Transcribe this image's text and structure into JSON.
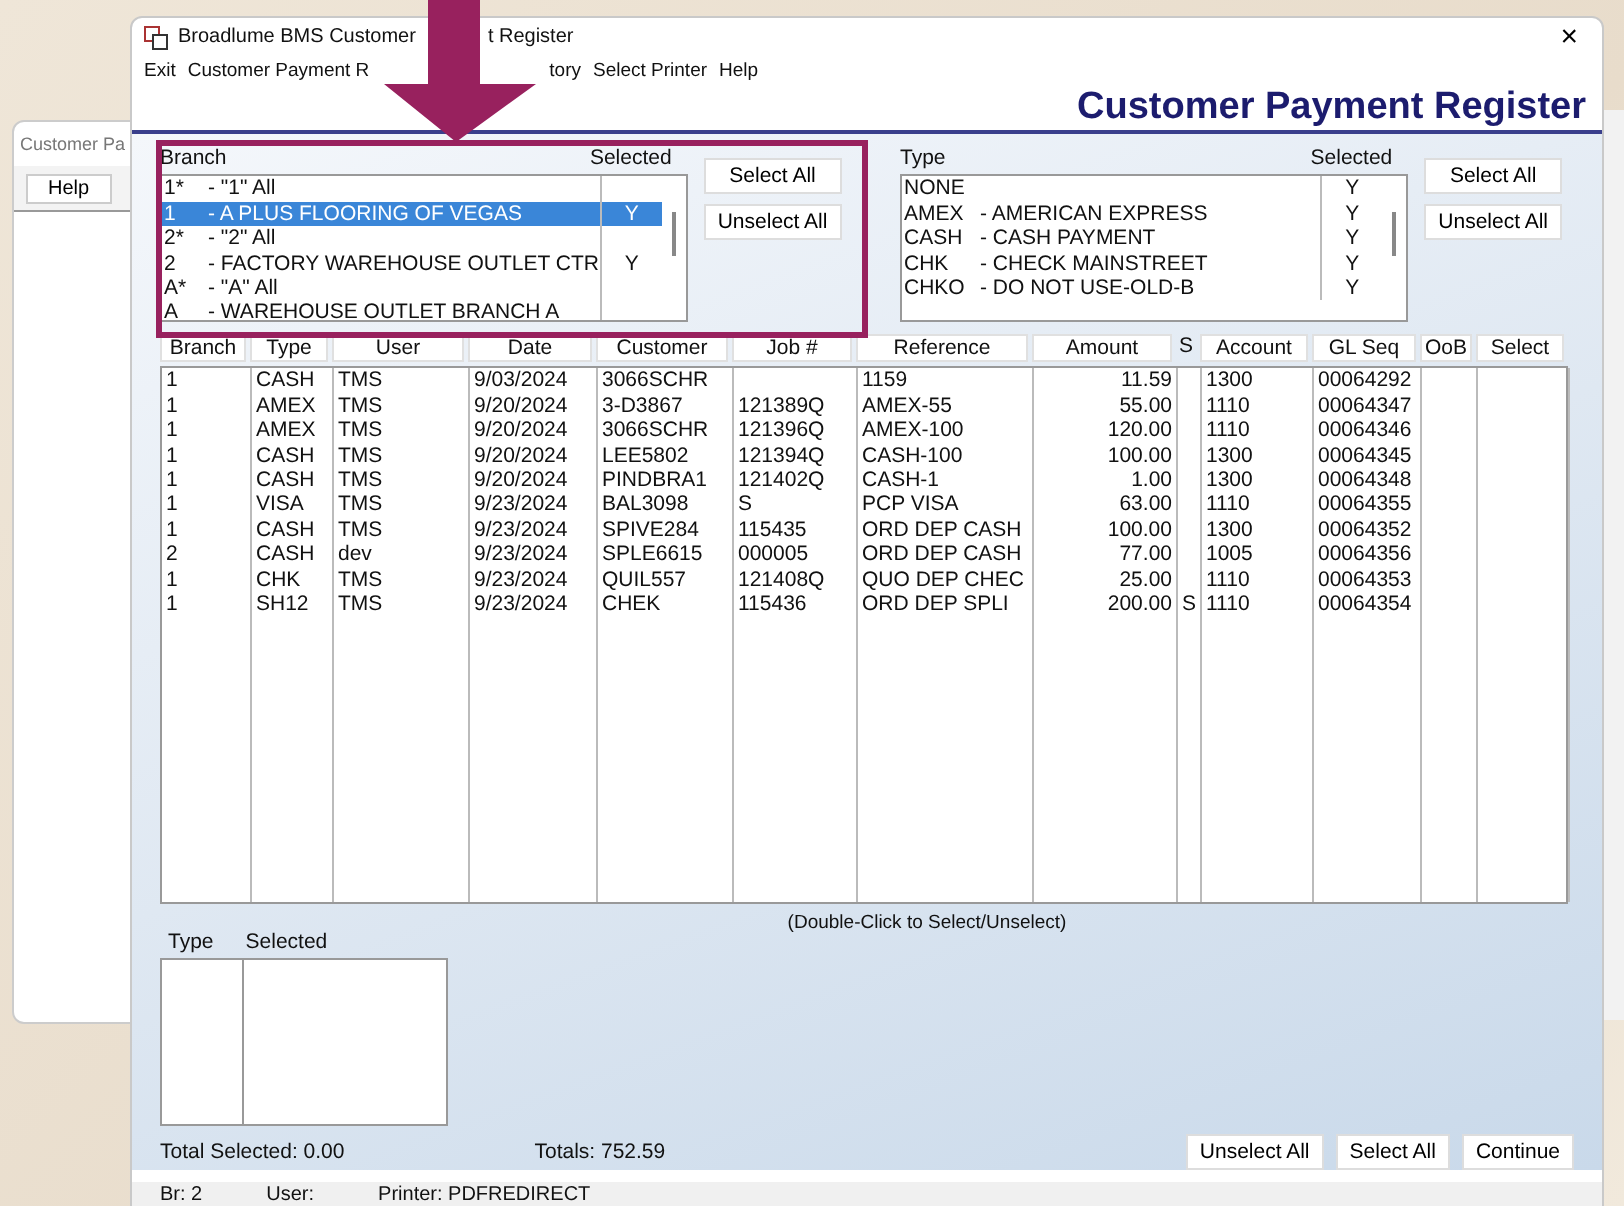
{
  "background_window": {
    "title": "Customer Pa",
    "button": "Help"
  },
  "window": {
    "title_parts": [
      "Broadlume BMS Customer ",
      "t Register"
    ],
    "close": "×"
  },
  "menu": [
    "Exit",
    "Customer Payment R",
    "tory",
    "Select Printer",
    "Help"
  ],
  "header": {
    "title": "Customer Payment Register"
  },
  "branch_list": {
    "columns": [
      "Branch",
      "Selected"
    ],
    "items": [
      {
        "code": "1*",
        "name": "- \"1\" All",
        "selected": false
      },
      {
        "code": "1",
        "name": "- A PLUS FLOORING OF VEGAS",
        "flag": "Y",
        "selected": true
      },
      {
        "code": "2*",
        "name": "- \"2\" All",
        "selected": false
      },
      {
        "code": "2",
        "name": "- FACTORY WAREHOUSE OUTLET CTR",
        "flag": "Y",
        "selected": false
      },
      {
        "code": "A*",
        "name": "- \"A\" All",
        "selected": false
      },
      {
        "code": "A",
        "name": "- WAREHOUSE OUTLET BRANCH A",
        "selected": false
      }
    ],
    "buttons": [
      "Select All",
      "Unselect All"
    ]
  },
  "type_list": {
    "columns": [
      "Type",
      "Selected"
    ],
    "items": [
      {
        "code": "NONE",
        "flag": "Y",
        "selected": false
      },
      {
        "code": "AMEX",
        "name": "- AMERICAN EXPRESS",
        "flag": "Y",
        "selected": false
      },
      {
        "code": "CASH",
        "name": "- CASH PAYMENT",
        "flag": "Y",
        "selected": false
      },
      {
        "code": "CHK",
        "name": "- CHECK MAINSTREET",
        "flag": "Y",
        "selected": false
      },
      {
        "code": "CHKO",
        "name": "- DO NOT USE-OLD-B",
        "flag": "Y",
        "selected": false
      }
    ],
    "buttons": [
      "Select All",
      "Unselect All"
    ]
  },
  "table": {
    "columns": [
      "Branch",
      "Type",
      "User",
      "Date",
      "Customer",
      "Job #",
      "Reference",
      "Amount",
      "S",
      "Account",
      "GL Seq",
      "OoB",
      "Select"
    ],
    "rows": [
      [
        "1",
        "CASH",
        "TMS",
        "9/03/2024",
        "3066SCHR",
        "",
        "1159",
        "11.59",
        "",
        "1300",
        "00064292",
        "",
        ""
      ],
      [
        "1",
        "AMEX",
        "TMS",
        "9/20/2024",
        "3-D3867",
        "121389Q",
        "AMEX-55",
        "55.00",
        "",
        "1110",
        "00064347",
        "",
        ""
      ],
      [
        "1",
        "AMEX",
        "TMS",
        "9/20/2024",
        "3066SCHR",
        "121396Q",
        "AMEX-100",
        "120.00",
        "",
        "1110",
        "00064346",
        "",
        ""
      ],
      [
        "1",
        "CASH",
        "TMS",
        "9/20/2024",
        "LEE5802",
        "121394Q",
        "CASH-100",
        "100.00",
        "",
        "1300",
        "00064345",
        "",
        ""
      ],
      [
        "1",
        "CASH",
        "TMS",
        "9/20/2024",
        "PINDBRA1",
        "121402Q",
        "CASH-1",
        "1.00",
        "",
        "1300",
        "00064348",
        "",
        ""
      ],
      [
        "1",
        "VISA",
        "TMS",
        "9/23/2024",
        "BAL3098",
        "S",
        "PCP VISA",
        "63.00",
        "",
        "1110",
        "00064355",
        "",
        ""
      ],
      [
        "1",
        "CASH",
        "TMS",
        "9/23/2024",
        "SPIVE284",
        "115435",
        "ORD DEP CASH",
        "100.00",
        "",
        "1300",
        "00064352",
        "",
        ""
      ],
      [
        "2",
        "CASH",
        "dev",
        "9/23/2024",
        "SPLE6615",
        "000005",
        "ORD DEP CASH",
        "77.00",
        "",
        "1005",
        "00064356",
        "",
        ""
      ],
      [
        "1",
        "CHK",
        "TMS",
        "9/23/2024",
        "QUIL557",
        "121408Q",
        "QUO DEP CHEC",
        "25.00",
        "",
        "1110",
        "00064353",
        "",
        ""
      ],
      [
        "1",
        "SH12",
        "TMS",
        "9/23/2024",
        "CHEK",
        "115436",
        "ORD DEP SPLI",
        "200.00",
        "S",
        "1110",
        "00064354",
        "",
        ""
      ]
    ]
  },
  "hint": "(Double-Click to Select/Unselect)",
  "selected_types": {
    "columns": [
      "Type",
      "Selected"
    ]
  },
  "total_selected": "Total Selected: 0.00",
  "totals": "Totals: 752.59",
  "footer_buttons": [
    "Unselect All",
    "Select All",
    "Continue"
  ],
  "status_bar": [
    "Br: 2",
    "User:",
    "Printer: PDFREDIRECT"
  ]
}
